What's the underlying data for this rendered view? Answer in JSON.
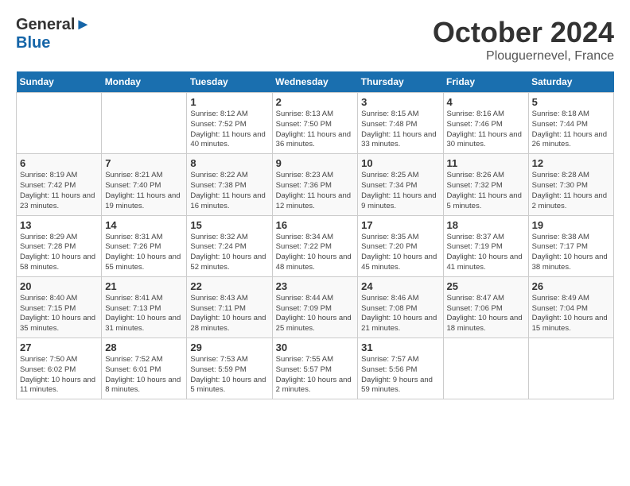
{
  "header": {
    "logo_general": "General",
    "logo_blue": "Blue",
    "month": "October 2024",
    "location": "Plouguernevel, France"
  },
  "days_of_week": [
    "Sunday",
    "Monday",
    "Tuesday",
    "Wednesday",
    "Thursday",
    "Friday",
    "Saturday"
  ],
  "weeks": [
    [
      {
        "day": "",
        "info": ""
      },
      {
        "day": "",
        "info": ""
      },
      {
        "day": "1",
        "info": "Sunrise: 8:12 AM\nSunset: 7:52 PM\nDaylight: 11 hours\nand 40 minutes."
      },
      {
        "day": "2",
        "info": "Sunrise: 8:13 AM\nSunset: 7:50 PM\nDaylight: 11 hours\nand 36 minutes."
      },
      {
        "day": "3",
        "info": "Sunrise: 8:15 AM\nSunset: 7:48 PM\nDaylight: 11 hours\nand 33 minutes."
      },
      {
        "day": "4",
        "info": "Sunrise: 8:16 AM\nSunset: 7:46 PM\nDaylight: 11 hours\nand 30 minutes."
      },
      {
        "day": "5",
        "info": "Sunrise: 8:18 AM\nSunset: 7:44 PM\nDaylight: 11 hours\nand 26 minutes."
      }
    ],
    [
      {
        "day": "6",
        "info": "Sunrise: 8:19 AM\nSunset: 7:42 PM\nDaylight: 11 hours\nand 23 minutes."
      },
      {
        "day": "7",
        "info": "Sunrise: 8:21 AM\nSunset: 7:40 PM\nDaylight: 11 hours\nand 19 minutes."
      },
      {
        "day": "8",
        "info": "Sunrise: 8:22 AM\nSunset: 7:38 PM\nDaylight: 11 hours\nand 16 minutes."
      },
      {
        "day": "9",
        "info": "Sunrise: 8:23 AM\nSunset: 7:36 PM\nDaylight: 11 hours\nand 12 minutes."
      },
      {
        "day": "10",
        "info": "Sunrise: 8:25 AM\nSunset: 7:34 PM\nDaylight: 11 hours\nand 9 minutes."
      },
      {
        "day": "11",
        "info": "Sunrise: 8:26 AM\nSunset: 7:32 PM\nDaylight: 11 hours\nand 5 minutes."
      },
      {
        "day": "12",
        "info": "Sunrise: 8:28 AM\nSunset: 7:30 PM\nDaylight: 11 hours\nand 2 minutes."
      }
    ],
    [
      {
        "day": "13",
        "info": "Sunrise: 8:29 AM\nSunset: 7:28 PM\nDaylight: 10 hours\nand 58 minutes."
      },
      {
        "day": "14",
        "info": "Sunrise: 8:31 AM\nSunset: 7:26 PM\nDaylight: 10 hours\nand 55 minutes."
      },
      {
        "day": "15",
        "info": "Sunrise: 8:32 AM\nSunset: 7:24 PM\nDaylight: 10 hours\nand 52 minutes."
      },
      {
        "day": "16",
        "info": "Sunrise: 8:34 AM\nSunset: 7:22 PM\nDaylight: 10 hours\nand 48 minutes."
      },
      {
        "day": "17",
        "info": "Sunrise: 8:35 AM\nSunset: 7:20 PM\nDaylight: 10 hours\nand 45 minutes."
      },
      {
        "day": "18",
        "info": "Sunrise: 8:37 AM\nSunset: 7:19 PM\nDaylight: 10 hours\nand 41 minutes."
      },
      {
        "day": "19",
        "info": "Sunrise: 8:38 AM\nSunset: 7:17 PM\nDaylight: 10 hours\nand 38 minutes."
      }
    ],
    [
      {
        "day": "20",
        "info": "Sunrise: 8:40 AM\nSunset: 7:15 PM\nDaylight: 10 hours\nand 35 minutes."
      },
      {
        "day": "21",
        "info": "Sunrise: 8:41 AM\nSunset: 7:13 PM\nDaylight: 10 hours\nand 31 minutes."
      },
      {
        "day": "22",
        "info": "Sunrise: 8:43 AM\nSunset: 7:11 PM\nDaylight: 10 hours\nand 28 minutes."
      },
      {
        "day": "23",
        "info": "Sunrise: 8:44 AM\nSunset: 7:09 PM\nDaylight: 10 hours\nand 25 minutes."
      },
      {
        "day": "24",
        "info": "Sunrise: 8:46 AM\nSunset: 7:08 PM\nDaylight: 10 hours\nand 21 minutes."
      },
      {
        "day": "25",
        "info": "Sunrise: 8:47 AM\nSunset: 7:06 PM\nDaylight: 10 hours\nand 18 minutes."
      },
      {
        "day": "26",
        "info": "Sunrise: 8:49 AM\nSunset: 7:04 PM\nDaylight: 10 hours\nand 15 minutes."
      }
    ],
    [
      {
        "day": "27",
        "info": "Sunrise: 7:50 AM\nSunset: 6:02 PM\nDaylight: 10 hours\nand 11 minutes."
      },
      {
        "day": "28",
        "info": "Sunrise: 7:52 AM\nSunset: 6:01 PM\nDaylight: 10 hours\nand 8 minutes."
      },
      {
        "day": "29",
        "info": "Sunrise: 7:53 AM\nSunset: 5:59 PM\nDaylight: 10 hours\nand 5 minutes."
      },
      {
        "day": "30",
        "info": "Sunrise: 7:55 AM\nSunset: 5:57 PM\nDaylight: 10 hours\nand 2 minutes."
      },
      {
        "day": "31",
        "info": "Sunrise: 7:57 AM\nSunset: 5:56 PM\nDaylight: 9 hours\nand 59 minutes."
      },
      {
        "day": "",
        "info": ""
      },
      {
        "day": "",
        "info": ""
      }
    ]
  ]
}
